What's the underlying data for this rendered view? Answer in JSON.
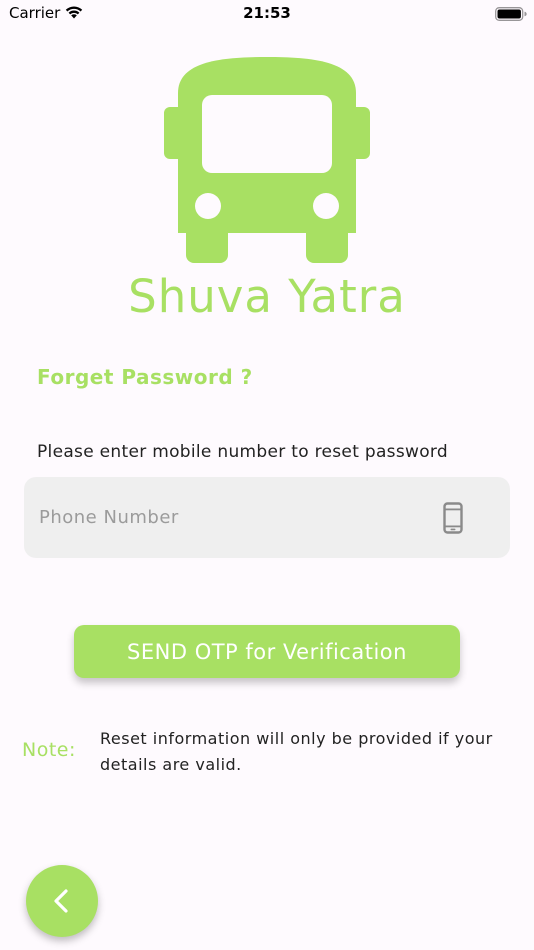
{
  "status_bar": {
    "carrier": "Carrier",
    "time": "21:53"
  },
  "app": {
    "title": "Shuva Yatra",
    "logo_icon": "bus-icon",
    "accent_color": "#a8e063"
  },
  "form": {
    "title": "Forget Password ?",
    "instruction": "Please enter mobile number to reset password",
    "phone_placeholder": "Phone Number",
    "phone_value": "",
    "phone_icon": "smartphone-icon",
    "send_button_label": "SEND OTP for Verification"
  },
  "note": {
    "label": "Note:",
    "text": "Reset information will only be provided if your details are valid."
  },
  "navigation": {
    "back_icon": "chevron-left-icon"
  }
}
